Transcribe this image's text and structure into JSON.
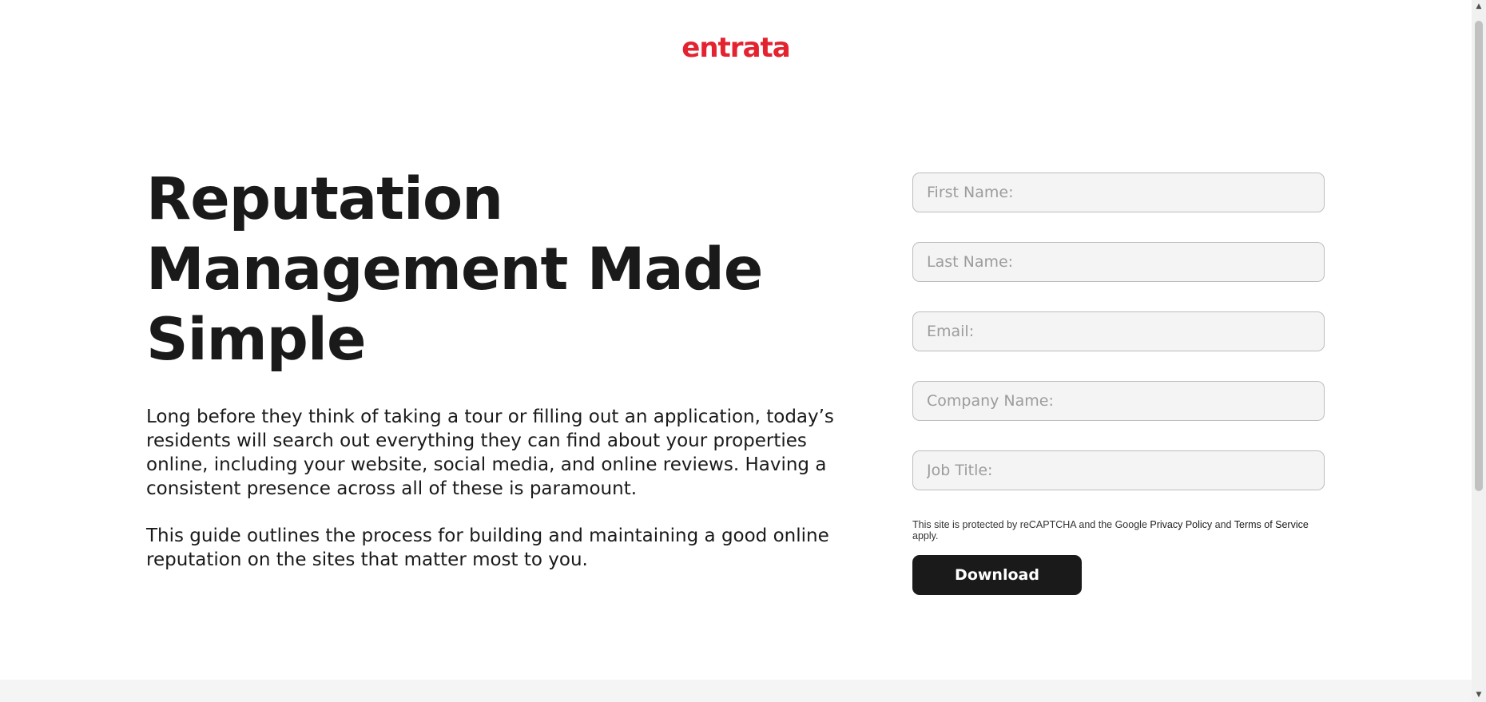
{
  "brand": {
    "logo_text": "entrata",
    "logo_color": "#e3232f"
  },
  "hero": {
    "headline_lines": [
      "Reputation",
      "Management Made",
      "Simple"
    ],
    "paragraph_1": "Long before they think of taking a tour or filling out an application, today’s residents will search out everything they can find about your properties online, including your website, social media, and online reviews. Having a consistent presence across all of these is paramount.",
    "paragraph_2": "This guide outlines the process for building and maintaining a good online reputation on the sites that matter most to you."
  },
  "form": {
    "fields": [
      {
        "placeholder": "First Name:",
        "value": ""
      },
      {
        "placeholder": "Last Name:",
        "value": ""
      },
      {
        "placeholder": "Email:",
        "value": ""
      },
      {
        "placeholder": "Company Name:",
        "value": ""
      },
      {
        "placeholder": "Job Title:",
        "value": ""
      }
    ],
    "recaptcha": {
      "prefix": "This site is protected by reCAPTCHA and the Google ",
      "privacy_link": "Privacy Policy",
      "middle": " and ",
      "terms_link": "Terms of Service",
      "suffix": " apply."
    },
    "submit_label": "Download"
  },
  "colors": {
    "accent": "#e3232f",
    "button_bg": "#1a1a1a",
    "field_bg": "#f4f4f4"
  }
}
